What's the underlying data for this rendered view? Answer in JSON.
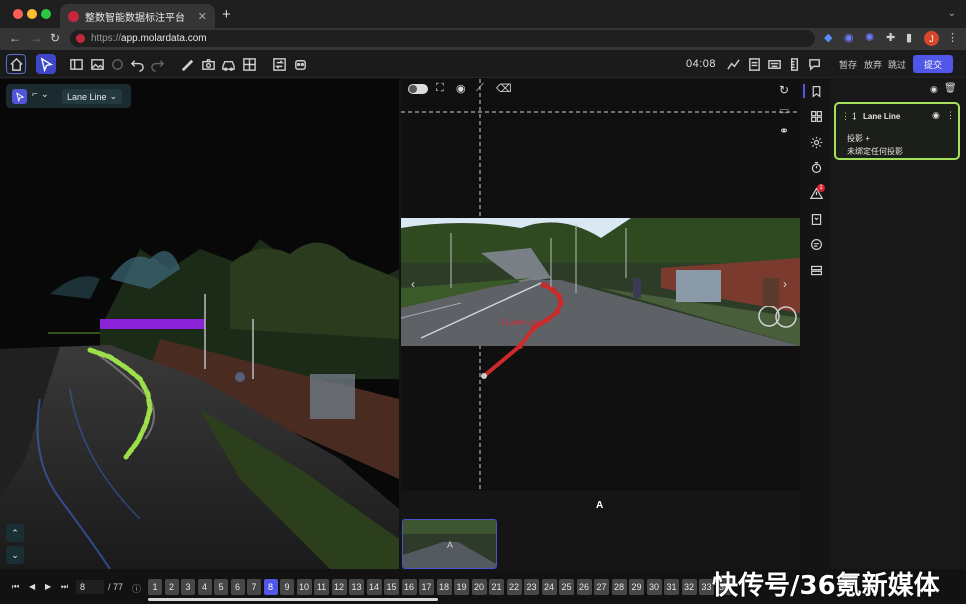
{
  "browser": {
    "tab_title": "整数智能数据标注平台",
    "url_protocol": "https://",
    "url_host": "app.molardata.com",
    "avatar_letter": "J"
  },
  "toolbar": {
    "timer": "04:08",
    "save_label": "暂存",
    "discard_label": "放弃",
    "skip_label": "跳过",
    "submit_label": "提交"
  },
  "view3d": {
    "lane_type_select": "Lane Line"
  },
  "view2d": {
    "lane_label": "1 Lane Line",
    "thumb_label": "A",
    "camera_name": "A"
  },
  "annotation": {
    "index": "1",
    "name": "Lane Line",
    "projection_label": "投影 +",
    "projection_status": "未绑定任何投影"
  },
  "alerts": {
    "count": "1"
  },
  "pagination": {
    "current": "8",
    "total": "/ 77",
    "pages": [
      "1",
      "2",
      "3",
      "4",
      "5",
      "6",
      "7",
      "8",
      "9",
      "10",
      "11",
      "12",
      "13",
      "14",
      "15",
      "16",
      "17",
      "18",
      "19",
      "20",
      "21",
      "22",
      "23",
      "24",
      "25",
      "26",
      "27",
      "28",
      "29",
      "30",
      "31",
      "32",
      "33",
      "34"
    ],
    "active": "8"
  },
  "watermark": "快传号/36氪新媒体",
  "colors": {
    "accent": "#5056e8",
    "selected_card": "#a6e05a",
    "lane_points": "#cc2b2b",
    "lane_3d": "#9be04a"
  }
}
